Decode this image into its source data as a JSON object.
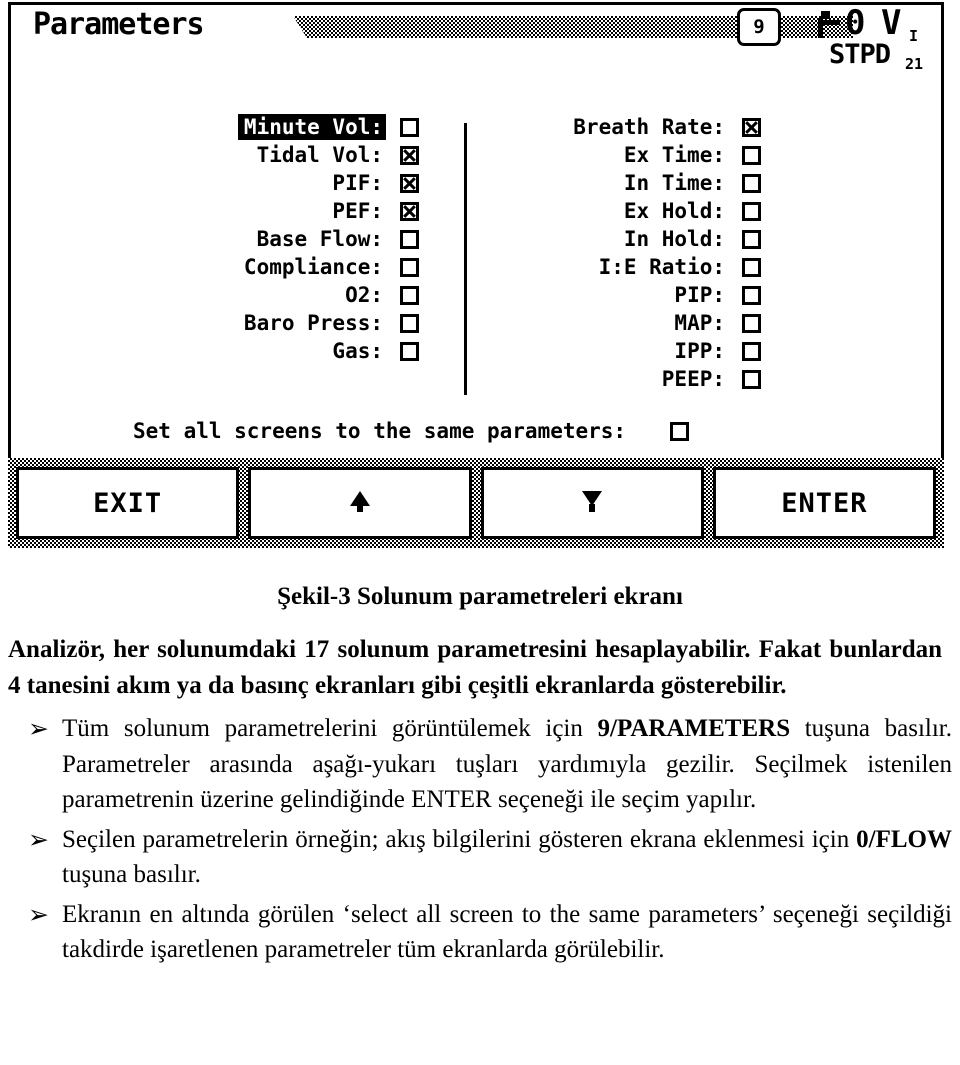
{
  "lcd": {
    "title": "Parameters",
    "screen_number": "9",
    "status": {
      "faucet_icon": "faucet-valve-icon",
      "zero": "0",
      "v_symbol": "V",
      "v_subscript": "I",
      "stpd": "STPD",
      "stpd_subscript": "21"
    },
    "left_column": [
      {
        "label": "Minute Vol:",
        "checked": false,
        "selected": true
      },
      {
        "label": "Tidal Vol:",
        "checked": true,
        "selected": false
      },
      {
        "label": "PIF:",
        "checked": true,
        "selected": false
      },
      {
        "label": "PEF:",
        "checked": true,
        "selected": false
      },
      {
        "label": "Base Flow:",
        "checked": false,
        "selected": false
      },
      {
        "label": "Compliance:",
        "checked": false,
        "selected": false
      },
      {
        "label": "O2:",
        "checked": false,
        "selected": false
      },
      {
        "label": "Baro Press:",
        "checked": false,
        "selected": false
      },
      {
        "label": "Gas:",
        "checked": false,
        "selected": false
      }
    ],
    "right_column": [
      {
        "label": "Breath Rate:",
        "checked": true,
        "selected": false
      },
      {
        "label": "Ex Time:",
        "checked": false,
        "selected": false
      },
      {
        "label": "In Time:",
        "checked": false,
        "selected": false
      },
      {
        "label": "Ex Hold:",
        "checked": false,
        "selected": false
      },
      {
        "label": "In Hold:",
        "checked": false,
        "selected": false
      },
      {
        "label": "I:E Ratio:",
        "checked": false,
        "selected": false
      },
      {
        "label": "PIP:",
        "checked": false,
        "selected": false
      },
      {
        "label": "MAP:",
        "checked": false,
        "selected": false
      },
      {
        "label": "IPP:",
        "checked": false,
        "selected": false
      },
      {
        "label": "PEEP:",
        "checked": false,
        "selected": false
      }
    ],
    "set_all": {
      "label": "Set all screens to the same parameters:",
      "checked": false
    },
    "buttons": [
      {
        "label": "EXIT",
        "icon": null
      },
      {
        "label": "",
        "icon": "arrow-up-icon"
      },
      {
        "label": "",
        "icon": "arrow-down-icon"
      },
      {
        "label": "ENTER",
        "icon": null
      }
    ]
  },
  "document": {
    "caption": "Şekil-3 Solunum parametreleri ekranı",
    "intro": "Analizör, her solunumdaki 17 solunum parametresini hesaplayabilir. Fakat bunlardan 4 tanesini akım ya da basınç ekranları gibi çeşitli ekranlarda gösterebilir.",
    "bullet_glyph": "➢",
    "bullets": [
      {
        "part1": "Tüm solunum parametrelerini görüntülemek için ",
        "bold1": "9/PARAMETERS",
        "part2": " tuşuna basılır. Parametreler arasında aşağı-yukarı tuşları yardımıyla gezilir. Seçilmek istenilen parametrenin üzerine gelindiğinde ENTER seçeneği ile seçim yapılır."
      },
      {
        "part1": "Seçilen parametrelerin örneğin; akış bilgilerini gösteren ekrana eklenmesi için ",
        "bold1": "0/FLOW",
        "part2": " tuşuna basılır."
      },
      {
        "part1": "Ekranın en altında görülen ‘select all screen to the same parameters’ seçeneği seçildiği takdirde işaretlenen parametreler tüm ekranlarda görülebilir.",
        "bold1": "",
        "part2": ""
      }
    ]
  }
}
